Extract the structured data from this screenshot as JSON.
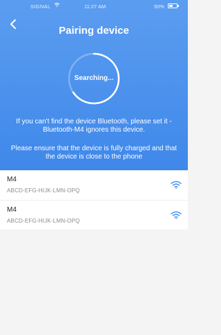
{
  "status_bar": {
    "carrier": "SIGNAL",
    "time": "11:27 AM",
    "battery": "50%",
    "battery_level": 0.5
  },
  "header": {
    "title": "Pairing device",
    "back_icon": "chevron-left-icon"
  },
  "scan": {
    "status": "Searching..."
  },
  "notices": [
    "If you can't find the device Bluetooth, please set it -Bluetooth-M4 ignores this device.",
    "Please ensure that the device is fully charged and that the device is close to the phone"
  ],
  "devices": [
    {
      "name": "M4",
      "id": "ABCD-EFG-HIJK-LMN-OPQ",
      "icon": "wifi-signal-icon"
    },
    {
      "name": "M4",
      "id": "ABCD-EFG-HIJK-LMN-OPQ",
      "icon": "wifi-signal-icon"
    }
  ],
  "colors": {
    "header_top": "#5b9df0",
    "header_bottom": "#3f88ea",
    "signal_icon": "#3f8ef0",
    "background": "#f4f4f4"
  }
}
